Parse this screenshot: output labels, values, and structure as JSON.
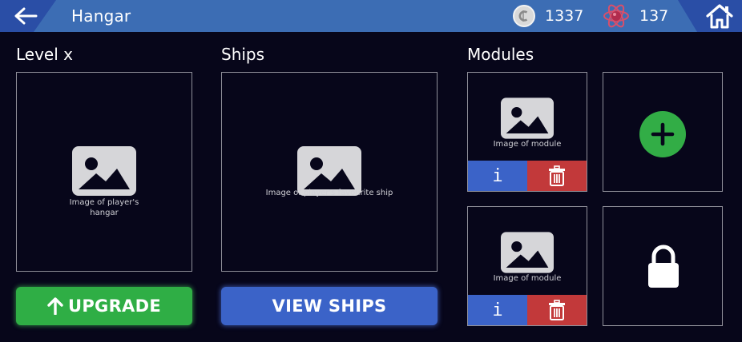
{
  "header": {
    "title": "Hangar",
    "back_icon": "arrow-left-icon",
    "home_icon": "home-icon",
    "coins": {
      "icon": "coin-icon",
      "value": "1337"
    },
    "energy": {
      "icon": "atom-icon",
      "value": "137"
    }
  },
  "hangar": {
    "heading": "Level x",
    "image_caption": "Image of player's hangar",
    "upgrade_label": "UPGRADE"
  },
  "ships": {
    "heading": "Ships",
    "image_caption": "Image of player's favourite ship",
    "view_label": "VIEW SHIPS"
  },
  "modules": {
    "heading": "Modules",
    "slots": [
      {
        "image_caption": "Image of module",
        "info_label": "i"
      },
      {
        "state": "add",
        "icon": "plus-icon"
      },
      {
        "image_caption": "Image of module",
        "info_label": "i"
      },
      {
        "state": "locked",
        "icon": "lock-icon"
      }
    ]
  },
  "colors": {
    "background": "#07061a",
    "topbar": "#3c6db4",
    "accent_green": "#2fae45",
    "accent_blue": "#3b63c8",
    "danger_red": "#c2393a"
  }
}
